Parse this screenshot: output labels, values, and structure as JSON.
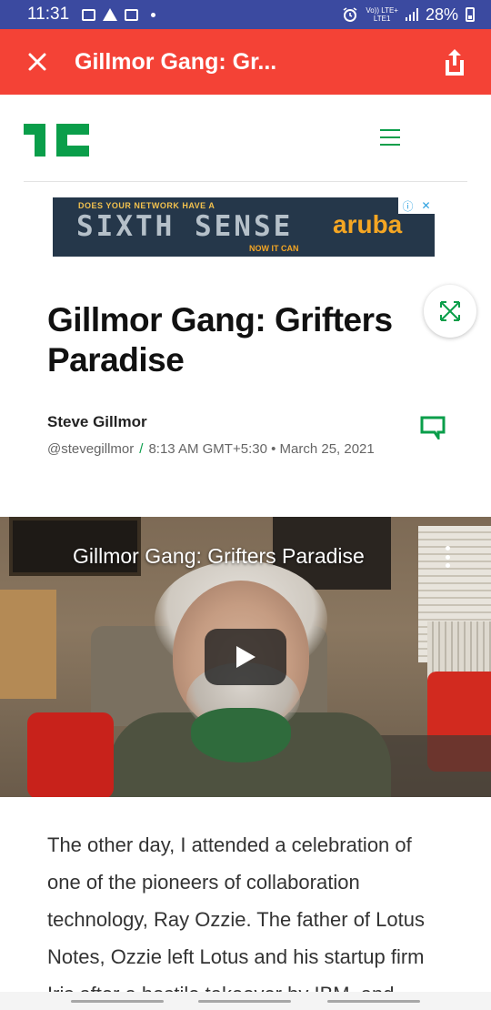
{
  "status_bar": {
    "time": "11:31",
    "network_top": "Vo)) LTE+",
    "network_bottom": "LTE1",
    "battery": "28%"
  },
  "app_bar": {
    "title": "Gillmor Gang: Gr...",
    "close_icon": "close-icon",
    "share_icon": "share-icon",
    "color": "#f44236"
  },
  "site": {
    "logo": "TC",
    "logo_color": "#0a9e4a",
    "menu_icon": "hamburger-menu-icon"
  },
  "ad": {
    "line1": "DOES YOUR NETWORK HAVE A",
    "line2": "SIXTH SENSE",
    "line3": "NOW IT CAN",
    "brand": "aruba"
  },
  "article": {
    "title": "Gillmor Gang: Grifters Paradise",
    "author": "Steve Gillmor",
    "handle": "@stevegillmor",
    "separator": "/",
    "datetime": "8:13 AM GMT+5:30 • March 25, 2021",
    "body": "The other day, I attended a celebration of one of the pioneers of collaboration technology, Ray Ozzie. The father of Lotus Notes, Ozzie left Lotus and his startup firm Iris after a hostile takeover by IBM, and"
  },
  "video": {
    "title": "Gillmor Gang: Grifters Paradise"
  }
}
